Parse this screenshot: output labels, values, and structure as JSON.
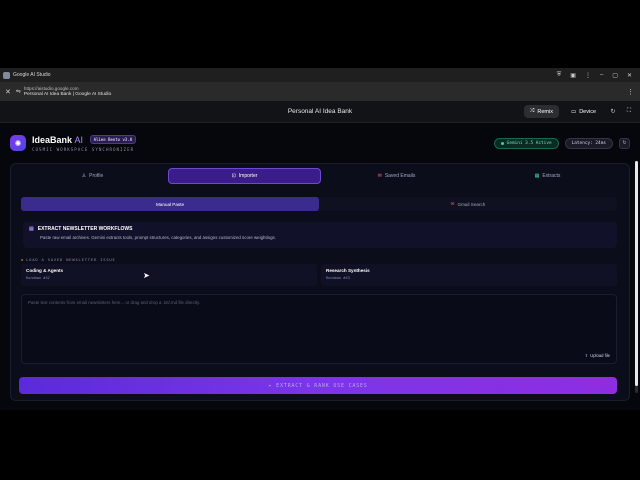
{
  "window": {
    "title": "Google AI Studio"
  },
  "address": {
    "url": "https://aistudio.google.com",
    "page_title": "Personal AI Idea Bank | Google AI Studio"
  },
  "appbar": {
    "title": "Personal AI Idea Bank",
    "remix_label": "Remix",
    "device_label": "Device"
  },
  "header": {
    "brand_name": "IdeaBank",
    "brand_suffix": "AI",
    "version_badge": "Alien Bento v3.0",
    "tagline": "COSMIC WORKSPACE SYNCHRONIZER",
    "status_chip": "Gemini 3.5 Active",
    "latency_chip": "Latency: 24ms"
  },
  "tabs": [
    {
      "label": "Profile",
      "icon": "user-icon",
      "active": false
    },
    {
      "label": "Importer",
      "icon": "inbox-icon",
      "active": true
    },
    {
      "label": "Saved Emails",
      "icon": "mail-icon",
      "active": false
    },
    {
      "label": "Extracts",
      "icon": "grid-icon",
      "active": false
    }
  ],
  "subtabs": [
    {
      "label": "Manual Paste",
      "active": true
    },
    {
      "label": "Gmail Search",
      "icon": "mail-icon",
      "active": false
    }
  ],
  "info": {
    "title": "EXTRACT NEWSLETTER WORKFLOWS",
    "description": "Paste raw email archives. Gemini extracts tools, prompt structures, categories, and assigns customized score weightings."
  },
  "section_label": "LOAD A SAVED NEWSLETTER ISSUE",
  "issues": [
    {
      "name": "Coding & Agents",
      "number": "Rundown #42"
    },
    {
      "name": "Research Synthesis",
      "number": "Rundown #43"
    }
  ],
  "textarea": {
    "placeholder": "Paste text contents from email newsletters here... or drag and drop a .txt/.md file directly.",
    "upload_label": "Upload file"
  },
  "extract_button": "EXTRACT & RANK USE CASES",
  "colors": {
    "accent": "#7c3aed",
    "active_tab": "#3b1d8a",
    "status_green": "#34d399",
    "background": "#06060d"
  }
}
